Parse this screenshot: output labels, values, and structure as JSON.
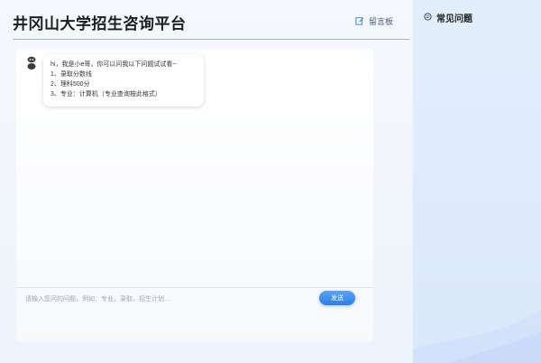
{
  "header": {
    "title": "井冈山大学招生咨询平台",
    "guestbook_label": "留言板",
    "guestbook_icon": "edit-icon"
  },
  "chat": {
    "bot_avatar_icon": "robot-icon",
    "welcome_lines": [
      "hi，我是小e哥，你可以问我以下问题试试看~",
      "1、录取分数线",
      "2、理科500分",
      "3、专业：计算机（专业查询按此格式）"
    ]
  },
  "input": {
    "placeholder": "请输入您问的问题，例如：专业，录取，招生计划....",
    "value": "",
    "send_label": "发送"
  },
  "faq": {
    "title": "常见问题",
    "icon": "chat-bubble-icon"
  },
  "colors": {
    "accent": "#2d7fe3",
    "sidebar_bg": "#e3eefc",
    "divider": "#9bb4d8"
  }
}
